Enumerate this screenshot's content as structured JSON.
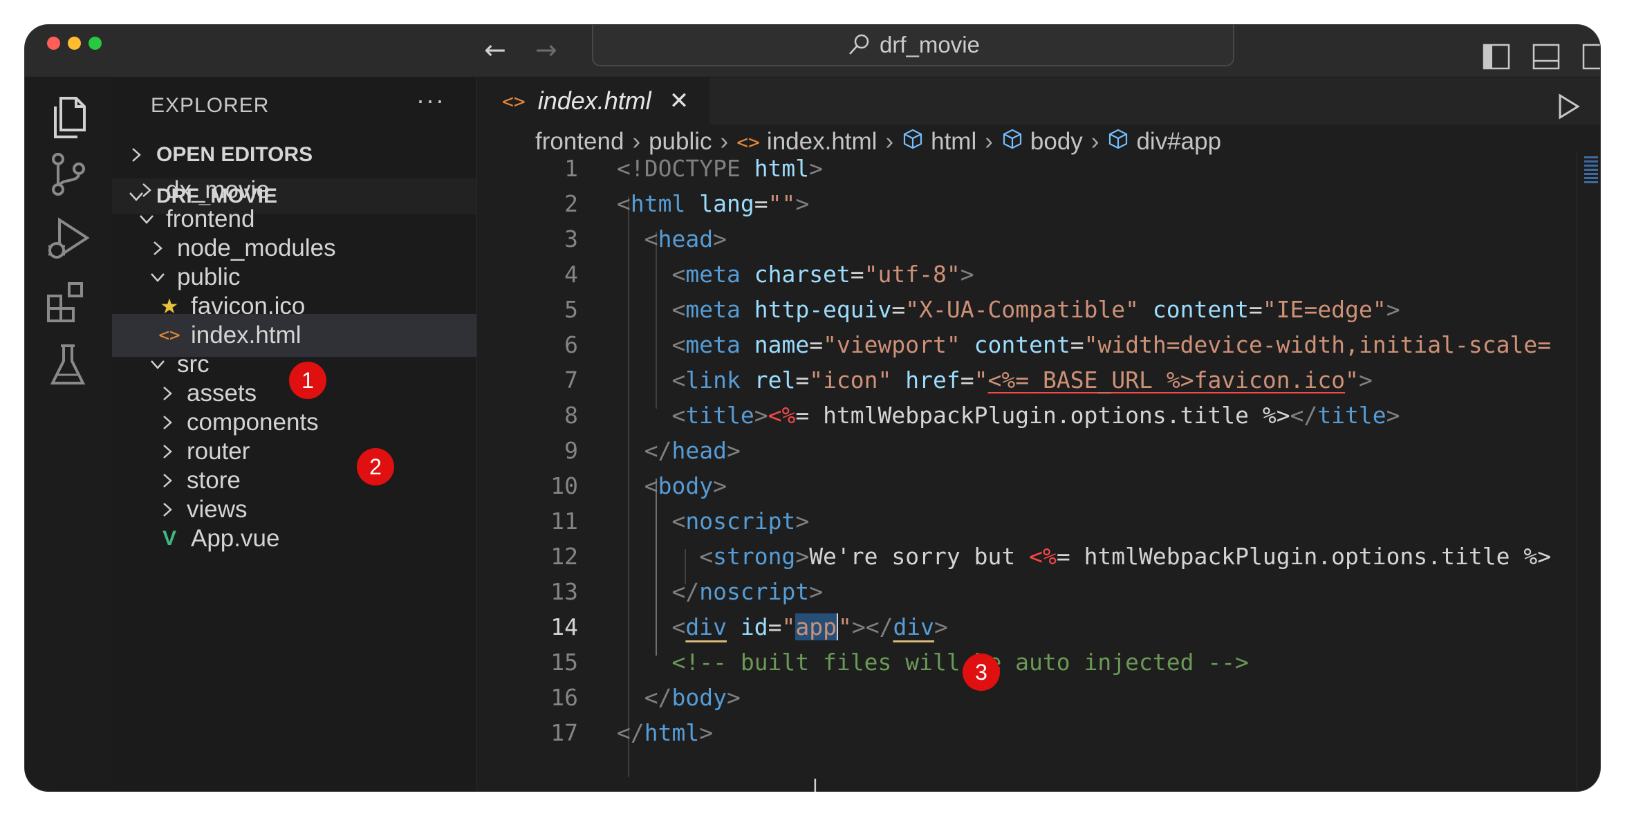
{
  "titlebar": {
    "search_text": "drf_movie",
    "back_glyph": "←",
    "forward_glyph": "→"
  },
  "sidebar": {
    "title": "EXPLORER",
    "more_glyph": "···",
    "open_editors": "OPEN EDITORS",
    "workspace": "DRF_MOVIE",
    "items": [
      {
        "label": "dx_movie",
        "type": "folder",
        "expanded": false
      },
      {
        "label": "frontend",
        "type": "folder",
        "expanded": true
      },
      {
        "label": "node_modules",
        "type": "folder",
        "expanded": false
      },
      {
        "label": "public",
        "type": "folder",
        "expanded": true
      },
      {
        "label": "favicon.ico",
        "type": "file",
        "icon": "star-icon"
      },
      {
        "label": "index.html",
        "type": "file",
        "icon": "code-icon",
        "selected": true
      },
      {
        "label": "src",
        "type": "folder",
        "expanded": true
      },
      {
        "label": "assets",
        "type": "folder",
        "expanded": false
      },
      {
        "label": "components",
        "type": "folder",
        "expanded": false
      },
      {
        "label": "router",
        "type": "folder",
        "expanded": false
      },
      {
        "label": "store",
        "type": "folder",
        "expanded": false
      },
      {
        "label": "views",
        "type": "folder",
        "expanded": false
      },
      {
        "label": "App.vue",
        "type": "file",
        "icon": "vue-icon"
      }
    ]
  },
  "badges": [
    "1",
    "2",
    "3"
  ],
  "editor": {
    "tab_label": "index.html",
    "tab_icon": "<>",
    "tab_close": "✕",
    "breadcrumbs": [
      "frontend",
      "public",
      "index.html",
      "html",
      "body",
      "div#app"
    ],
    "line_numbers": [
      "1",
      "2",
      "3",
      "4",
      "5",
      "6",
      "7",
      "8",
      "9",
      "10",
      "11",
      "12",
      "13",
      "14",
      "15",
      "16",
      "17"
    ],
    "active_line": "14"
  },
  "code_text": {
    "l1_doctype": "<!DOCTYPE",
    "l1_html": "html",
    "l7_tpl_open": "<%=",
    "l7_tpl_body": " BASE_URL ",
    "l7_tpl_close": "%>",
    "l7_rest": "favicon.ico",
    "l8_tpl_open": "<%",
    "l8_tpl_body": "= htmlWebpackPlugin.options.title %>",
    "l12_text": "We're sorry but ",
    "l12_tpl_open": "<%",
    "l12_tpl_body": "= htmlWebpackPlugin.options.title %>",
    "l14_app": "app",
    "l15_comment": "<!-- built files will be auto injected -->"
  },
  "colors": {
    "background": "#1e1e1e",
    "tag": "#569cd6",
    "attribute": "#9cdcfe",
    "string": "#ce9178",
    "comment": "#6a9955",
    "badge": "#e01010"
  }
}
